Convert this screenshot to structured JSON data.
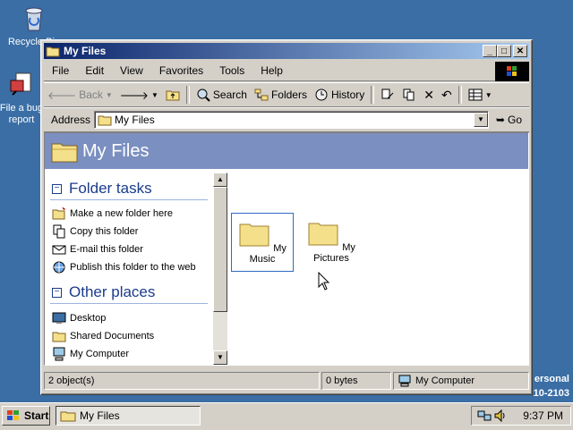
{
  "desktop": {
    "icons": [
      {
        "label": "Recycle Bin",
        "icon": "recycle-bin-icon"
      },
      {
        "label": "File a bug report",
        "icon": "bug-report-icon"
      }
    ],
    "version_lines": [
      "ersonal",
      "10-2103"
    ]
  },
  "window": {
    "title": "My Files",
    "controls": [
      "minimize",
      "maximize",
      "close"
    ]
  },
  "menu": [
    "File",
    "Edit",
    "View",
    "Favorites",
    "Tools",
    "Help"
  ],
  "toolbar": {
    "back": "Back",
    "search": "Search",
    "folders": "Folders",
    "history": "History"
  },
  "address": {
    "label": "Address",
    "value": "My Files",
    "go": "Go"
  },
  "banner": {
    "title": "My Files"
  },
  "left_pane": {
    "folder_tasks": {
      "title": "Folder tasks",
      "items": [
        {
          "label": "Make a new folder here",
          "icon": "new-folder-icon"
        },
        {
          "label": "Copy this folder",
          "icon": "copy-icon"
        },
        {
          "label": "E-mail this folder",
          "icon": "email-icon"
        },
        {
          "label": "Publish this folder to the web",
          "icon": "web-publish-icon"
        }
      ]
    },
    "other_places": {
      "title": "Other places",
      "items": [
        {
          "label": "Desktop",
          "icon": "desktop-icon"
        },
        {
          "label": "Shared Documents",
          "icon": "folder-icon"
        },
        {
          "label": "My Computer",
          "icon": "computer-icon"
        }
      ]
    }
  },
  "files": [
    {
      "name": "My Music",
      "selected": true
    },
    {
      "name": "My Pictures",
      "selected": false
    }
  ],
  "status": {
    "objects": "2 object(s)",
    "size": "0 bytes",
    "location": "My Computer"
  },
  "taskbar": {
    "start": "Start",
    "task": "My Files",
    "clock": "9:37 PM"
  },
  "colors": {
    "desktop": "#3a6ea5",
    "title_active_start": "#0a246a",
    "title_active_end": "#a6caf0",
    "banner": "#7b8fc0",
    "section_text": "#1a3c8c"
  }
}
